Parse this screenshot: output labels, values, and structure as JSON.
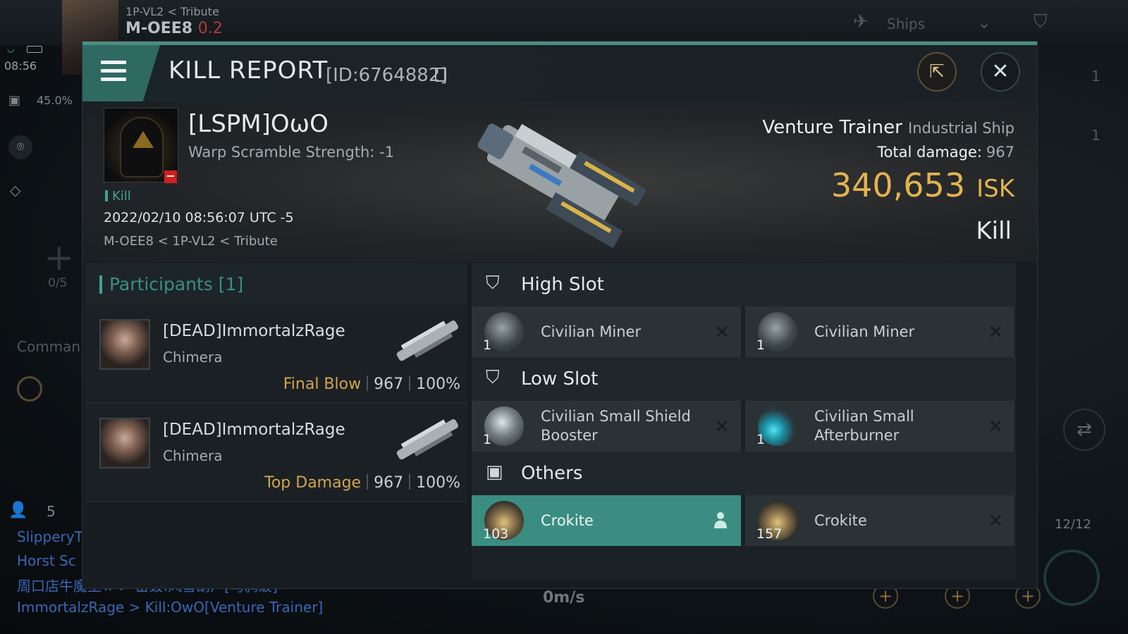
{
  "hud": {
    "location_small": "1P-VL2 < Tribute",
    "location_system": "M-OEE8",
    "location_security": "0.2",
    "clock": "08:56",
    "cargo_percent": "45.0%",
    "drone_count": "0/5",
    "command_label": "Comman",
    "chat_members": "5",
    "chat_lines": [
      "SlipperyT",
      "Horst Sc",
      "周口店牛魔王★ > 击毁:风雪葫芦[马鸦级]",
      "ImmortalzRage > Kill:OwO[Venture Trainer]"
    ],
    "ships_filter_label": "Ships",
    "speed": "0m/s",
    "ammo": "12/12",
    "right_counts": [
      "1",
      "1"
    ]
  },
  "report": {
    "title": "KILL REPORT",
    "id": "[ID:6764882]",
    "victim": {
      "name": "[LSPM]OωO",
      "warp_scramble": "Warp Scramble Strength: -1",
      "tag": "Kill",
      "datetime": "2022/02/10 08:56:07 UTC -5",
      "location": "M-OEE8 < 1P-VL2 < Tribute"
    },
    "ship": {
      "name": "Venture Trainer",
      "class": "Industrial Ship",
      "total_damage_label": "Total damage:",
      "total_damage": "967",
      "isk_value": "340,653",
      "isk_unit": "ISK",
      "result": "Kill"
    },
    "participants": {
      "title": "Participants [1]",
      "rows": [
        {
          "name": "[DEAD]ImmortalzRage",
          "ship": "Chimera",
          "role": "Final Blow",
          "damage": "967",
          "percent": "100%"
        },
        {
          "name": "[DEAD]ImmortalzRage",
          "ship": "Chimera",
          "role": "Top Damage",
          "damage": "967",
          "percent": "100%"
        }
      ]
    },
    "slots": {
      "high_slot": {
        "title": "High Slot",
        "items": [
          {
            "name": "Civilian Miner",
            "qty": "1",
            "status": "destroyed"
          },
          {
            "name": "Civilian Miner",
            "qty": "1",
            "status": "destroyed"
          }
        ]
      },
      "low_slot": {
        "title": "Low Slot",
        "items": [
          {
            "name": "Civilian Small Shield Booster",
            "qty": "1",
            "status": "destroyed"
          },
          {
            "name": "Civilian Small Afterburner",
            "qty": "1",
            "status": "destroyed"
          }
        ]
      },
      "others": {
        "title": "Others",
        "items": [
          {
            "name": "Crokite",
            "qty": "103",
            "status": "dropped"
          },
          {
            "name": "Crokite",
            "qty": "157",
            "status": "destroyed"
          }
        ]
      }
    }
  },
  "colors": {
    "accent_teal": "#3fa292",
    "header_teal": "#2e6a62",
    "isk_gold": "#e4b34f",
    "dropped_bg": "#3a8d80",
    "security_red": "#b43a3a"
  }
}
